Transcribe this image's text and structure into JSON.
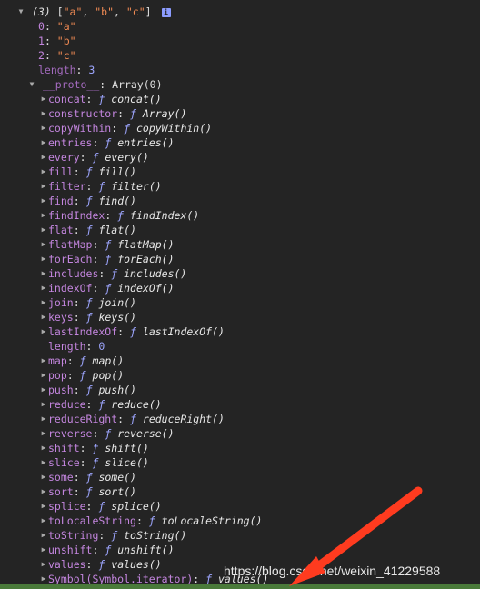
{
  "summary": {
    "count": "(3)",
    "preview_open": "[",
    "items": [
      "\"a\"",
      "\"b\"",
      "\"c\""
    ],
    "sep": ", ",
    "preview_close": "]",
    "info": "i"
  },
  "entries": [
    {
      "key": "0",
      "value": "\"a\""
    },
    {
      "key": "1",
      "value": "\"b\""
    },
    {
      "key": "2",
      "value": "\"c\""
    }
  ],
  "length_entry": {
    "key": "length",
    "value": "3"
  },
  "proto": {
    "key": "__proto__",
    "value": "Array(0)"
  },
  "methods": [
    {
      "key": "concat",
      "fn": "concat()"
    },
    {
      "key": "constructor",
      "fn": "Array()"
    },
    {
      "key": "copyWithin",
      "fn": "copyWithin()"
    },
    {
      "key": "entries",
      "fn": "entries()"
    },
    {
      "key": "every",
      "fn": "every()"
    },
    {
      "key": "fill",
      "fn": "fill()"
    },
    {
      "key": "filter",
      "fn": "filter()"
    },
    {
      "key": "find",
      "fn": "find()"
    },
    {
      "key": "findIndex",
      "fn": "findIndex()"
    },
    {
      "key": "flat",
      "fn": "flat()"
    },
    {
      "key": "flatMap",
      "fn": "flatMap()"
    },
    {
      "key": "forEach",
      "fn": "forEach()"
    },
    {
      "key": "includes",
      "fn": "includes()"
    },
    {
      "key": "indexOf",
      "fn": "indexOf()"
    },
    {
      "key": "join",
      "fn": "join()"
    },
    {
      "key": "keys",
      "fn": "keys()"
    },
    {
      "key": "lastIndexOf",
      "fn": "lastIndexOf()"
    },
    {
      "key": "length",
      "value": "0"
    },
    {
      "key": "map",
      "fn": "map()"
    },
    {
      "key": "pop",
      "fn": "pop()"
    },
    {
      "key": "push",
      "fn": "push()"
    },
    {
      "key": "reduce",
      "fn": "reduce()"
    },
    {
      "key": "reduceRight",
      "fn": "reduceRight()"
    },
    {
      "key": "reverse",
      "fn": "reverse()"
    },
    {
      "key": "shift",
      "fn": "shift()"
    },
    {
      "key": "slice",
      "fn": "slice()"
    },
    {
      "key": "some",
      "fn": "some()"
    },
    {
      "key": "sort",
      "fn": "sort()"
    },
    {
      "key": "splice",
      "fn": "splice()"
    },
    {
      "key": "toLocaleString",
      "fn": "toLocaleString()"
    },
    {
      "key": "toString",
      "fn": "toString()"
    },
    {
      "key": "unshift",
      "fn": "unshift()"
    },
    {
      "key": "values",
      "fn": "values()"
    },
    {
      "key": "Symbol(Symbol.iterator)",
      "fn": "values()"
    }
  ],
  "function_marker": "ƒ",
  "colon": ": ",
  "watermark": "https://blog.csdn.net/weixin_41229588",
  "colors": {
    "background": "#242424",
    "key": "#c486df",
    "string": "#f28b54",
    "number": "#9ea6ff",
    "annotation_arrow": "#ff3b1f"
  }
}
